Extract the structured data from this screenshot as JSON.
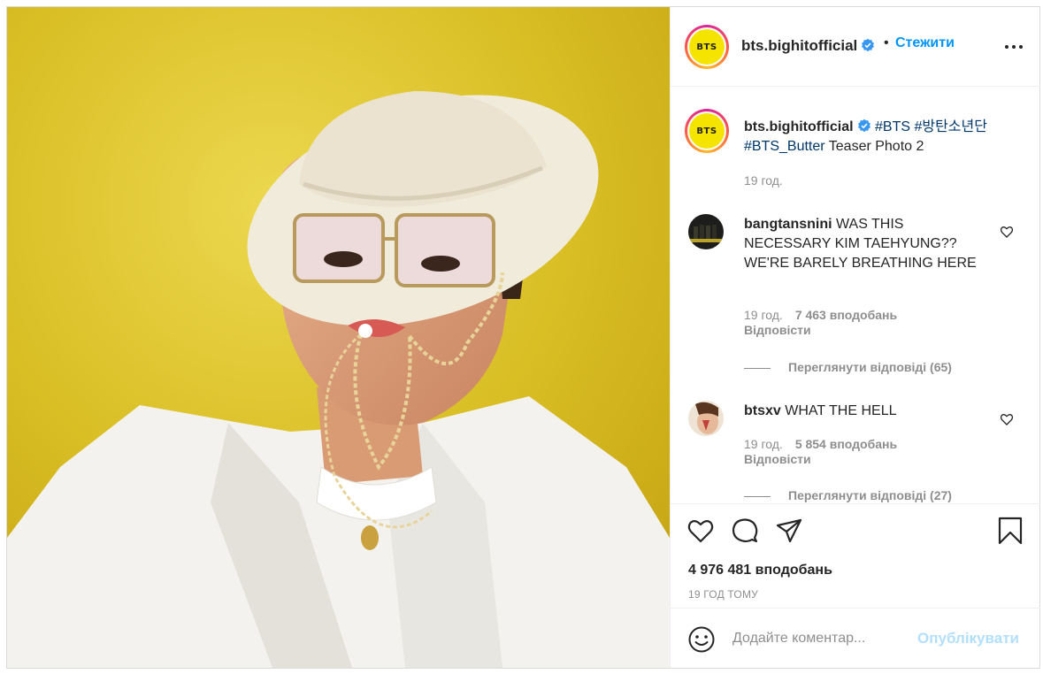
{
  "post": {
    "username": "bts.bighitofficial",
    "avatar_text": "BTS",
    "dot": "•",
    "follow_label": "Стежити",
    "more_icon": "more-options-icon"
  },
  "caption": {
    "username": "bts.bighitofficial",
    "tags": [
      "#BTS",
      "#방탄소년단",
      "#BTS_Butter"
    ],
    "text": "Teaser Photo 2",
    "time": "19 год."
  },
  "comments": [
    {
      "username": "bangtansnini",
      "text": "WAS THIS NECESSARY KIM TAEHYUNG?? WE'RE BARELY BREATHING HERE",
      "time": "19 год.",
      "likes": "7 463 вподобань",
      "reply_label": "Відповісти",
      "view_replies": "Переглянути відповіді (65)"
    },
    {
      "username": "btsxv",
      "text": "WHAT THE HELL",
      "time": "19 год.",
      "likes": "5 854 вподобань",
      "reply_label": "Відповісти",
      "view_replies": "Переглянути відповіді (27)"
    }
  ],
  "actions": {
    "likes_count": "4 976 481 вподобань",
    "time_ago": "19 ГОД ТОМУ"
  },
  "add_comment": {
    "placeholder": "Додайте коментар...",
    "publish_label": "Опублікувати"
  },
  "colors": {
    "accent": "#0095f6",
    "link": "#00376b",
    "muted": "#8e8e8e",
    "publish_disabled": "#b2dffc",
    "photo_bg": "#d8bd22"
  }
}
